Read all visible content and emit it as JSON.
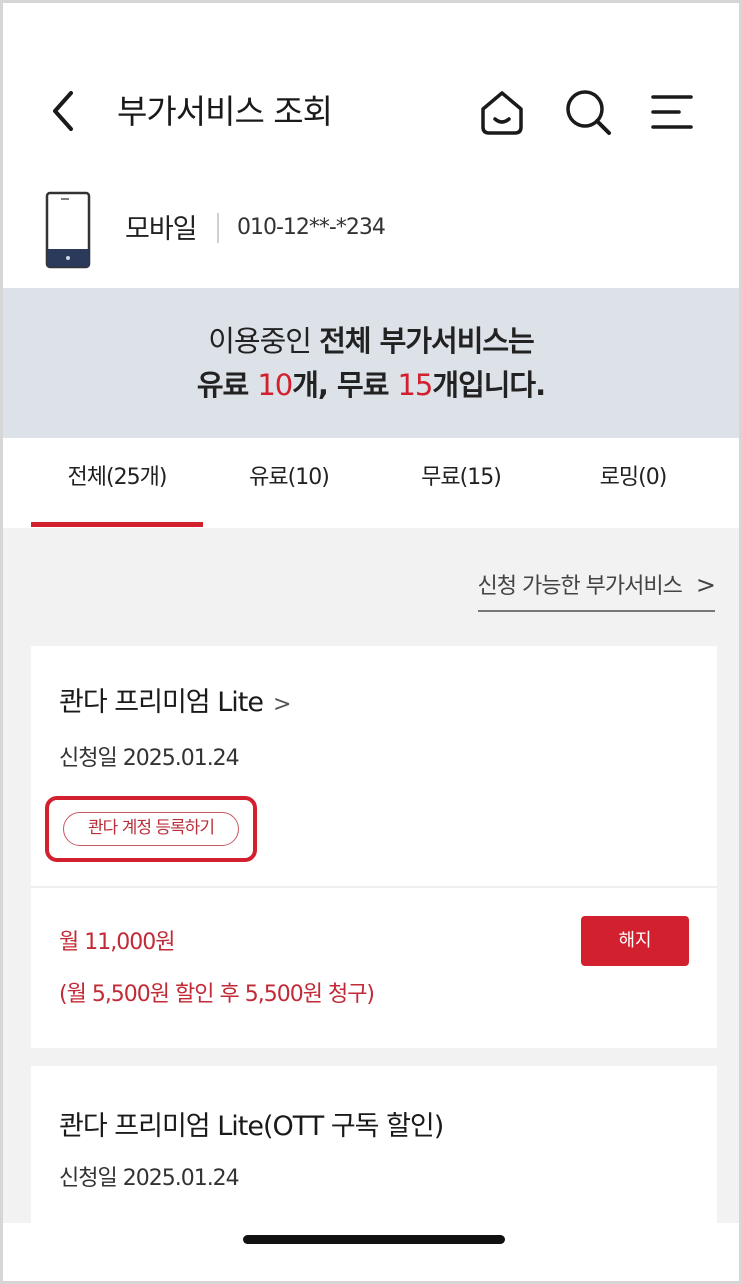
{
  "header": {
    "title": "부가서비스 조회",
    "icons": [
      "back-icon",
      "home-icon",
      "search-icon",
      "menu-icon"
    ]
  },
  "device": {
    "type_label": "모바일",
    "number": "010-12**-*234",
    "icon": "phone-icon"
  },
  "summary": {
    "line1_prefix": "이용중인 ",
    "line1_bold": "전체 부가서비스는",
    "line2_a": "유료 ",
    "paid_count": "10",
    "line2_b": "개, 무료 ",
    "free_count": "15",
    "line2_c": "개입니다."
  },
  "tabs": [
    {
      "label": "전체(25개)",
      "active": true
    },
    {
      "label": "유료(10)",
      "active": false
    },
    {
      "label": "무료(15)",
      "active": false
    },
    {
      "label": "로밍(0)",
      "active": false
    }
  ],
  "available_link": {
    "label": "신청 가능한 부가서비스",
    "chevron": ">"
  },
  "services": [
    {
      "title": "콴다 프리미엄 Lite",
      "chevron": ">",
      "date": "신청일 2025.01.24",
      "register_label": "콴다 계정 등록하기",
      "price": "월 11,000원",
      "price_detail": "(월 5,500원 할인 후 5,500원 청구)",
      "cancel_label": "해지"
    },
    {
      "title": "콴다 프리미엄 Lite(OTT 구독 할인)",
      "date": "신청일 2025.01.24"
    }
  ],
  "colors": {
    "accent": "#d2202e",
    "banner_bg": "#dde1e8",
    "content_bg": "#f2f2f2"
  }
}
